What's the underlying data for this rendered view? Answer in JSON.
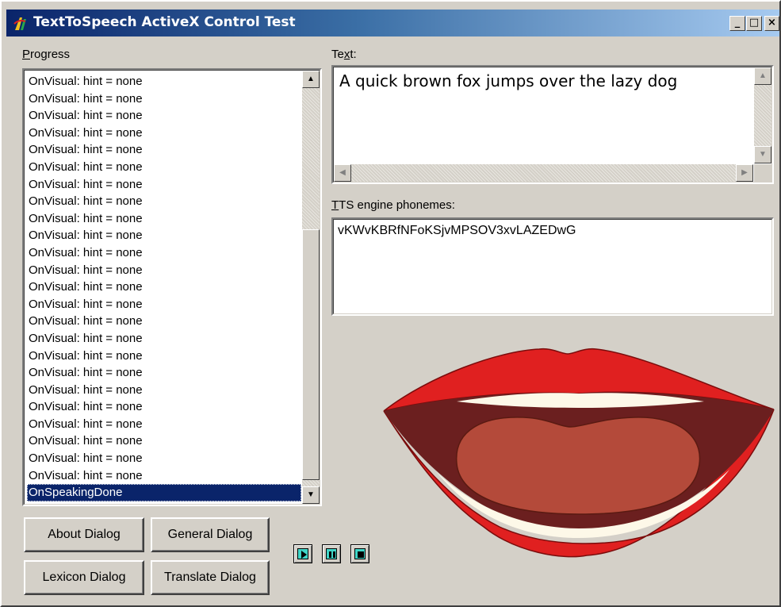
{
  "window": {
    "title": "TextToSpeech ActiveX Control Test",
    "controls": {
      "minimize": "_",
      "maximize": "□",
      "close": "×"
    }
  },
  "progress": {
    "label_underlined": "P",
    "label_rest": "rogress",
    "items": [
      "OnVisual: hint = none",
      "OnVisual: hint = none",
      "OnVisual: hint = none",
      "OnVisual: hint = none",
      "OnVisual: hint = none",
      "OnVisual: hint = none",
      "OnVisual: hint = none",
      "OnVisual: hint = none",
      "OnVisual: hint = none",
      "OnVisual: hint = none",
      "OnVisual: hint = none",
      "OnVisual: hint = none",
      "OnVisual: hint = none",
      "OnVisual: hint = none",
      "OnVisual: hint = none",
      "OnVisual: hint = none",
      "OnVisual: hint = none",
      "OnVisual: hint = none",
      "OnVisual: hint = none",
      "OnVisual: hint = none",
      "OnVisual: hint = none",
      "OnVisual: hint = none",
      "OnVisual: hint = none",
      "OnVisual: hint = none"
    ],
    "selected_item": "OnSpeakingDone"
  },
  "text": {
    "label_pre": "Te",
    "label_underlined": "x",
    "label_post": "t:",
    "value": "A quick brown fox jumps over the lazy dog"
  },
  "phonemes": {
    "label_underlined": "T",
    "label_rest": "TS engine phonemes:",
    "value": "vKWvKBRfNFoKSjvMPSOV3xvLAZEDwG"
  },
  "buttons": {
    "about": "About Dialog",
    "general": "General Dialog",
    "lexicon": "Lexicon Dialog",
    "translate": "Translate Dialog"
  },
  "media_controls": {
    "play_icon": "play-icon",
    "pause_icon": "pause-icon",
    "stop_icon": "stop-icon",
    "face_color": "#3fd6c8"
  },
  "mouth": {
    "lip_color": "#e02020",
    "inner_color": "#6b1f1f",
    "tongue_color": "#b44a3a",
    "teeth_color": "#fdf8e8"
  },
  "colors": {
    "title_gradient_start": "#0a246a",
    "title_gradient_end": "#a6caf0",
    "selection": "#0a246a",
    "face": "#d4d0c8"
  }
}
